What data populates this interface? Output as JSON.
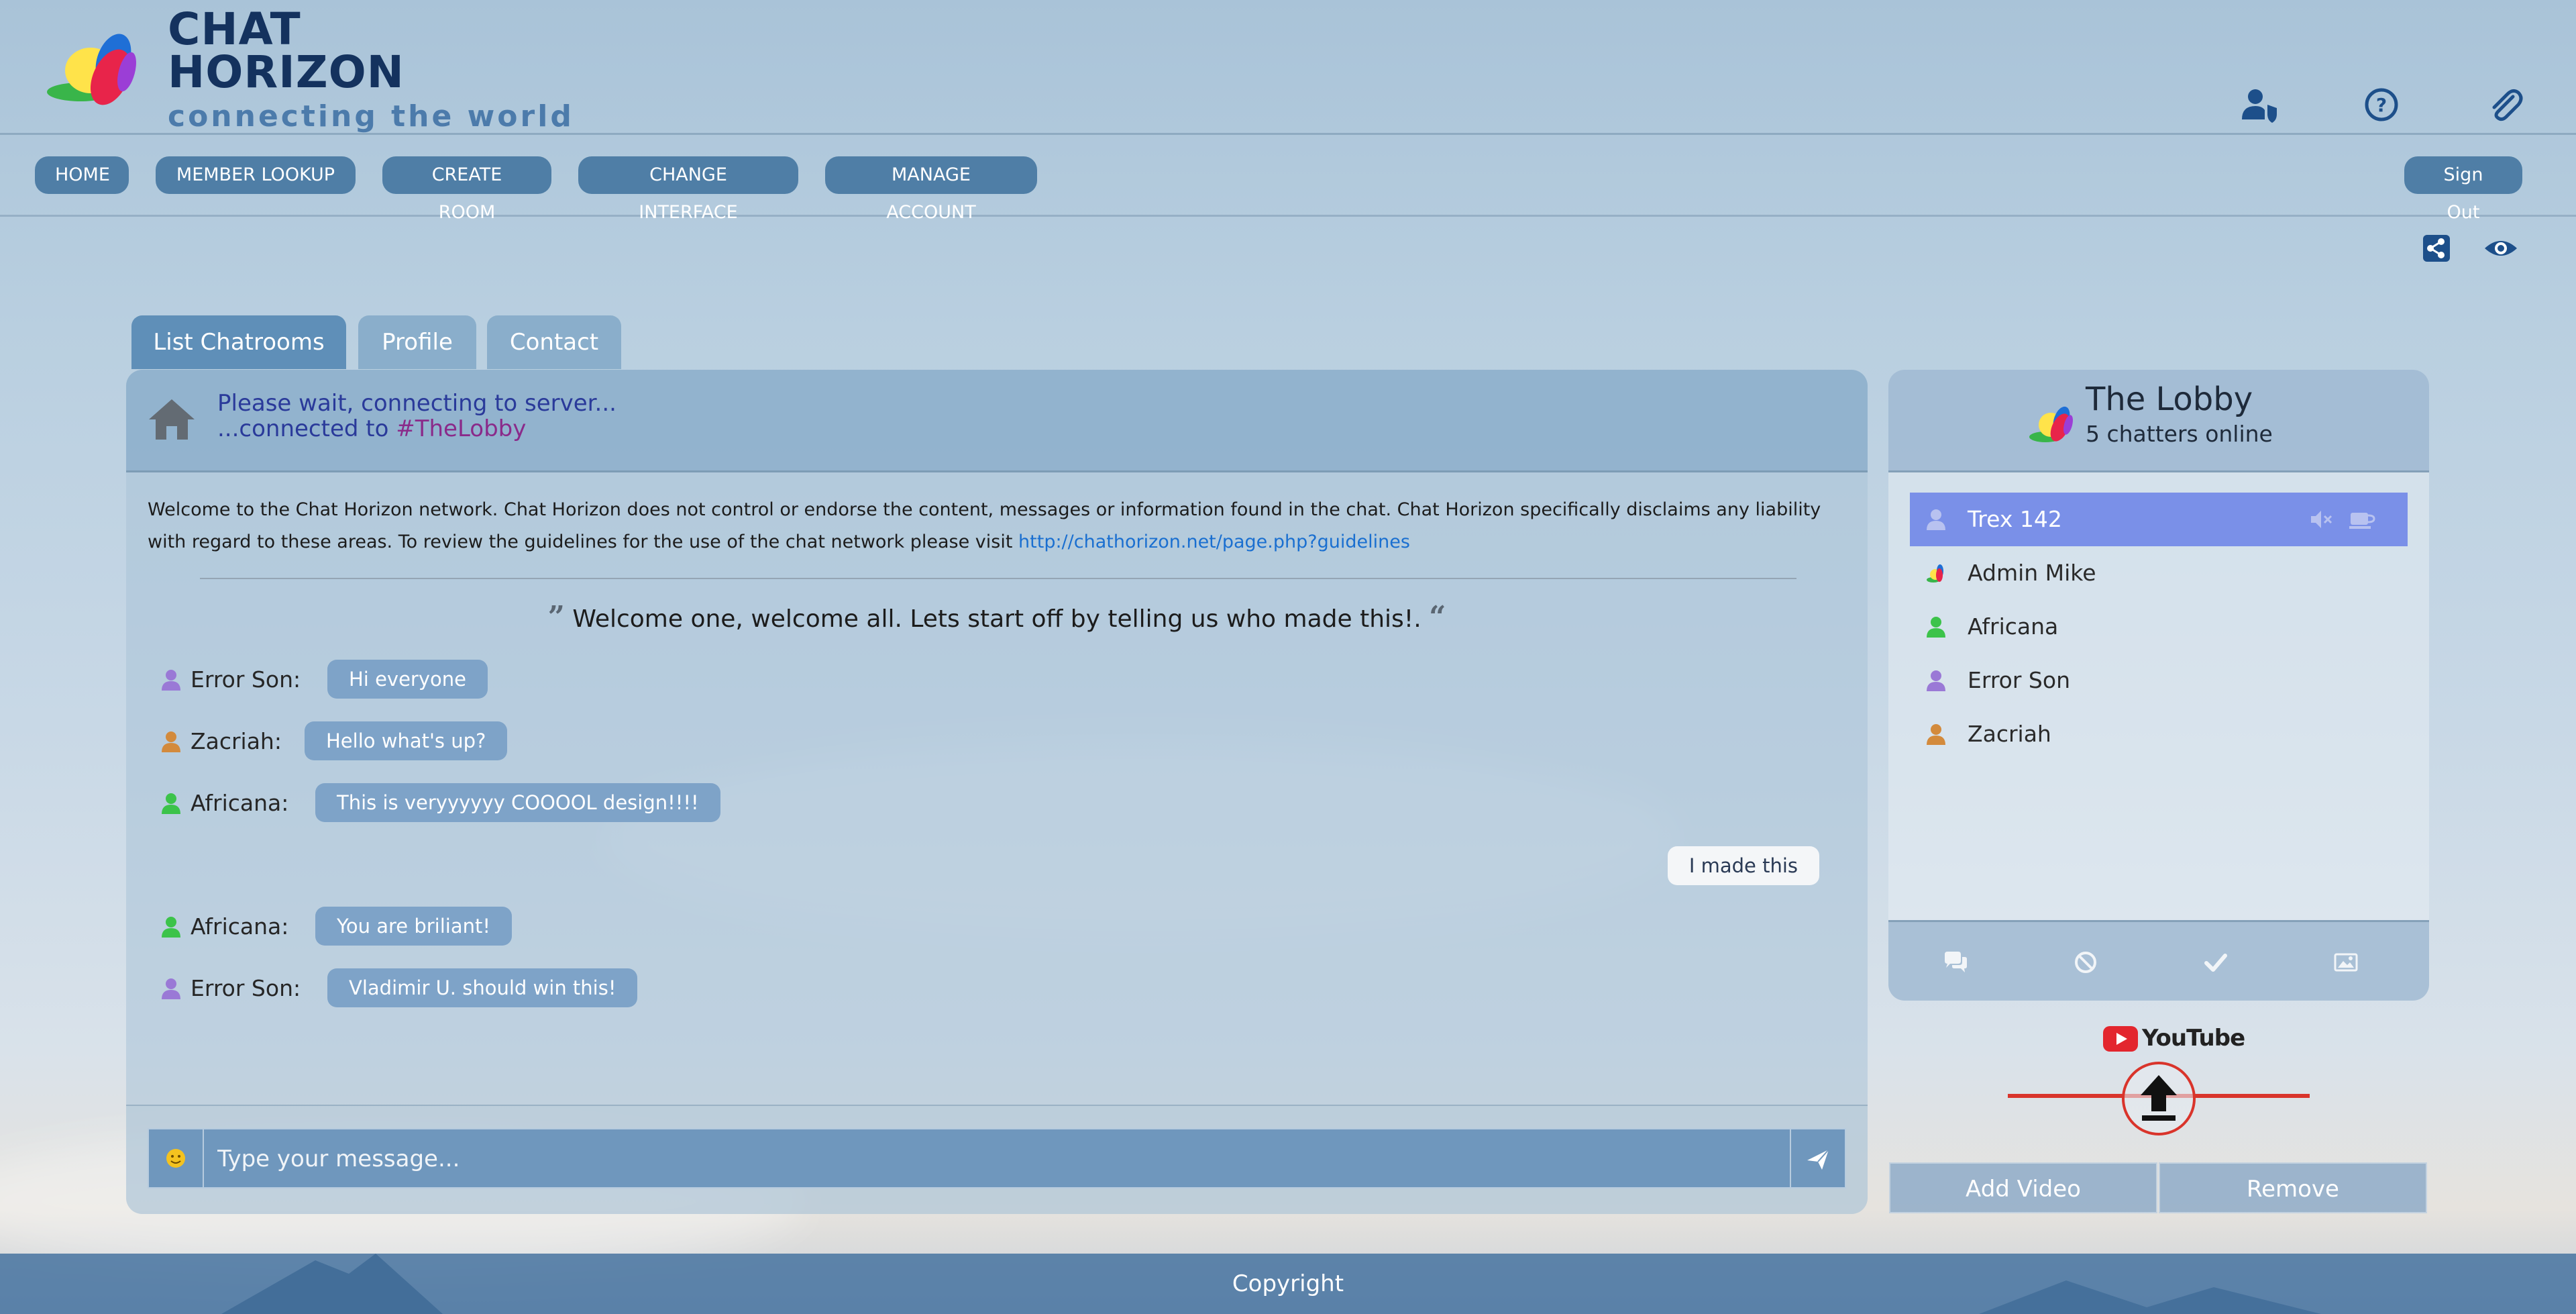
{
  "brand": {
    "title_line1": "CHAT",
    "title_line2": "HORIZON",
    "tagline": "connecting the world"
  },
  "header_icons": [
    "user-shield-icon",
    "help-circle-icon",
    "paperclip-icon"
  ],
  "nav": {
    "items": [
      {
        "label": "HOME"
      },
      {
        "label": "MEMBER LOOKUP"
      },
      {
        "label": "CREATE ROOM"
      },
      {
        "label": "CHANGE INTERFACE"
      },
      {
        "label": "MANAGE ACCOUNT"
      }
    ],
    "sign_out": "Sign Out"
  },
  "toolbar_icons": [
    "share-icon",
    "eye-icon"
  ],
  "tabs": [
    {
      "label": "List Chatrooms",
      "active": true
    },
    {
      "label": "Profile"
    },
    {
      "label": "Contact"
    }
  ],
  "chat": {
    "status_line1": "Please wait, connecting to server...",
    "status_line2_prefix": "...connected to ",
    "room_tag": "#TheLobby",
    "disclaimer_text": "Welcome to the Chat Horizon network. Chat Horizon does not control or endorse the content, messages or information found in the chat. Chat Horizon specifically disclaims any liability with regard to these areas. To review the guidelines for the use of the chat network please visit ",
    "disclaimer_link": "http://chathorizon.net/page.php?guidelines",
    "welcome": "Welcome one, welcome all. Lets start off by telling us who made this!.",
    "messages": [
      {
        "user": "Error Son:",
        "text": "Hi everyone",
        "color": "#9a79d6"
      },
      {
        "user": "Zacriah:",
        "text": "Hello what's up?",
        "color": "#d38a3c"
      },
      {
        "user": "Africana:",
        "text": "This is veryyyyyy COOOOL design!!!!",
        "color": "#3cc34a"
      },
      {
        "self": true,
        "text": "I made this"
      },
      {
        "user": "Africana:",
        "text": "You are briliant!",
        "color": "#3cc34a"
      },
      {
        "user": "Error Son:",
        "text": "Vladimir U. should win this!",
        "color": "#9a79d6"
      }
    ],
    "input_placeholder": "Type your message..."
  },
  "room": {
    "name": "The Lobby",
    "count": "5 chatters online",
    "users": [
      {
        "name": "Trex 142",
        "color": "#b8c2f0",
        "active": true
      },
      {
        "name": "Admin Mike",
        "color": "logo"
      },
      {
        "name": "Africana",
        "color": "#3cc34a"
      },
      {
        "name": "Error Son",
        "color": "#9a79d6"
      },
      {
        "name": "Zacriah",
        "color": "#d38a3c"
      }
    ],
    "footer_icons": [
      "chat-bubbles-icon",
      "block-icon",
      "check-icon",
      "image-icon"
    ]
  },
  "video": {
    "provider": "YouTube",
    "add_label": "Add Video",
    "remove_label": "Remove"
  },
  "footer": {
    "text": "Copyright"
  },
  "colors": {
    "nav_button": "#4f7ea6",
    "bubble": "#7ea3c8",
    "active_user": "#7a90e8",
    "youtube_red": "#d9342b",
    "footer_bar": "#4673a0"
  }
}
